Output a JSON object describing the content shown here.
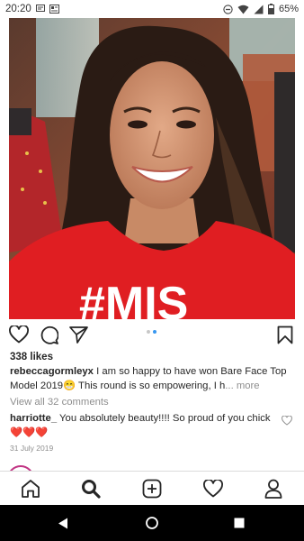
{
  "status_bar": {
    "time": "20:20",
    "battery": "65%",
    "left_icons": [
      "message-icon",
      "media-icon"
    ],
    "right_icons": [
      "do-not-disturb-icon",
      "wifi-icon",
      "signal-icon",
      "battery-icon"
    ]
  },
  "post": {
    "image": "selfie-photo",
    "carousel": {
      "count": 2,
      "active": 1
    },
    "likes": "338 likes",
    "caption": {
      "username": "rebeccagormleyx",
      "text": " I am so happy to have won Bare Face Top Model 2019😁 This round is so empowering, I h",
      "more": "... more"
    },
    "view_comments": "View all 32 comments",
    "comment": {
      "username": "harriotte_",
      "text": " You absolutely beauty!!!! So proud of you chick ❤️❤️❤️"
    },
    "date": "31 July 2019"
  },
  "actions": {
    "like": "heart-icon",
    "comment": "comment-icon",
    "share": "send-icon",
    "save": "bookmark-icon"
  },
  "bottom_nav": {
    "items": [
      "home-icon",
      "search-icon",
      "add-post-icon",
      "activity-heart-icon",
      "profile-icon"
    ],
    "active": "search-icon"
  },
  "colors": {
    "accent_blue": "#3897f0",
    "text": "#262626",
    "muted": "#8e8e8e",
    "shirt_red": "#e01e22"
  }
}
